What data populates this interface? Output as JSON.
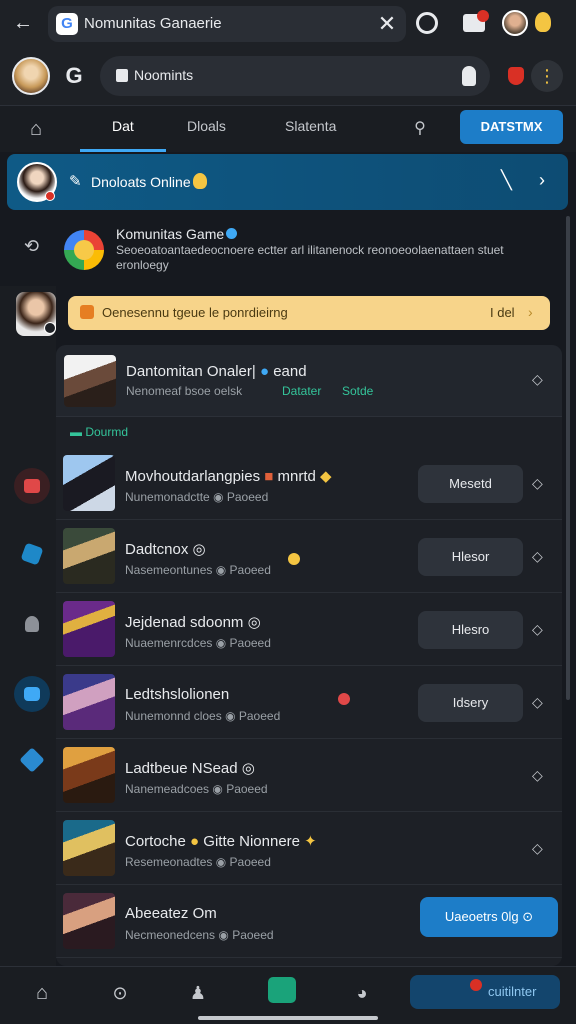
{
  "browser": {
    "tab_title": "Nomunitas Ganaerie",
    "favicon": "G",
    "back_glyph": "←",
    "close_glyph": "✕"
  },
  "address": {
    "google_logo": "G",
    "url": "Noomints"
  },
  "nav": {
    "tabs": [
      "Dat",
      "Dloals",
      "Slatenta"
    ],
    "cta": "DATSTMX"
  },
  "banner": {
    "text": "Dnoloats Online"
  },
  "community": {
    "name": "Komunitas Game",
    "description": "Seoeoatoantaedeocnoere ectter arl ilitanenock reonoeoolaenattaen stuet eronloegy"
  },
  "notice": {
    "text": "Oenesennu tgeue le ponrdieirng",
    "action": "I del"
  },
  "panel_header": {
    "title": "Dantomitan Onaler|",
    "title_suffix": "eand",
    "subtitle": "Nenomeaf bsoe oelsk",
    "tag_1": "Datater",
    "tag_2": "Sotde",
    "section": "Dourmd"
  },
  "items": [
    {
      "title": "Movhoutdarlangpies",
      "suffix": "mnrtd",
      "subtitle": "Nunemonadctte",
      "status": "Paoeed",
      "button": "Mesetd"
    },
    {
      "title": "Dadtcnox",
      "suffix": "",
      "subtitle": "Nasemeontunes",
      "status": "Paoeed",
      "button": "Hlesor"
    },
    {
      "title": "Jejdenad sdoonm",
      "suffix": "",
      "subtitle": "Nuaemenrcdces",
      "status": "Paoeed",
      "button": "Hlesro"
    },
    {
      "title": "Ledtshslolionen",
      "suffix": "",
      "subtitle": "Nunemonnd cloes",
      "status": "Paoeed",
      "button": "Idsery"
    },
    {
      "title": "Ladtbeue NSead",
      "suffix": "",
      "subtitle": "Nanemeadcoes",
      "status": "Paoeed",
      "button": ""
    },
    {
      "title": "Cortoche",
      "suffix": "Gitte Nionnere",
      "subtitle": "Resemeonadtes",
      "status": "Paoeed",
      "button": ""
    },
    {
      "title": "Abeeatez",
      "suffix": "Om",
      "subtitle": "Necmeonedcens",
      "status": "Paoeed",
      "button": ""
    }
  ],
  "featured_cta": "Uaeoetrs 0lg",
  "bottom_cta": "cuitilnter",
  "colors": {
    "accent": "#1d7dc8",
    "banner": "#0f5a86",
    "notice": "#f7d48a",
    "success": "#34c49a",
    "alert": "#d93025"
  },
  "icons": [
    "back-icon",
    "close-icon",
    "tab-switcher-icon",
    "video-icon",
    "lock-icon",
    "mic-icon",
    "shield-icon",
    "home-icon",
    "search-icon",
    "chevron-icon"
  ]
}
